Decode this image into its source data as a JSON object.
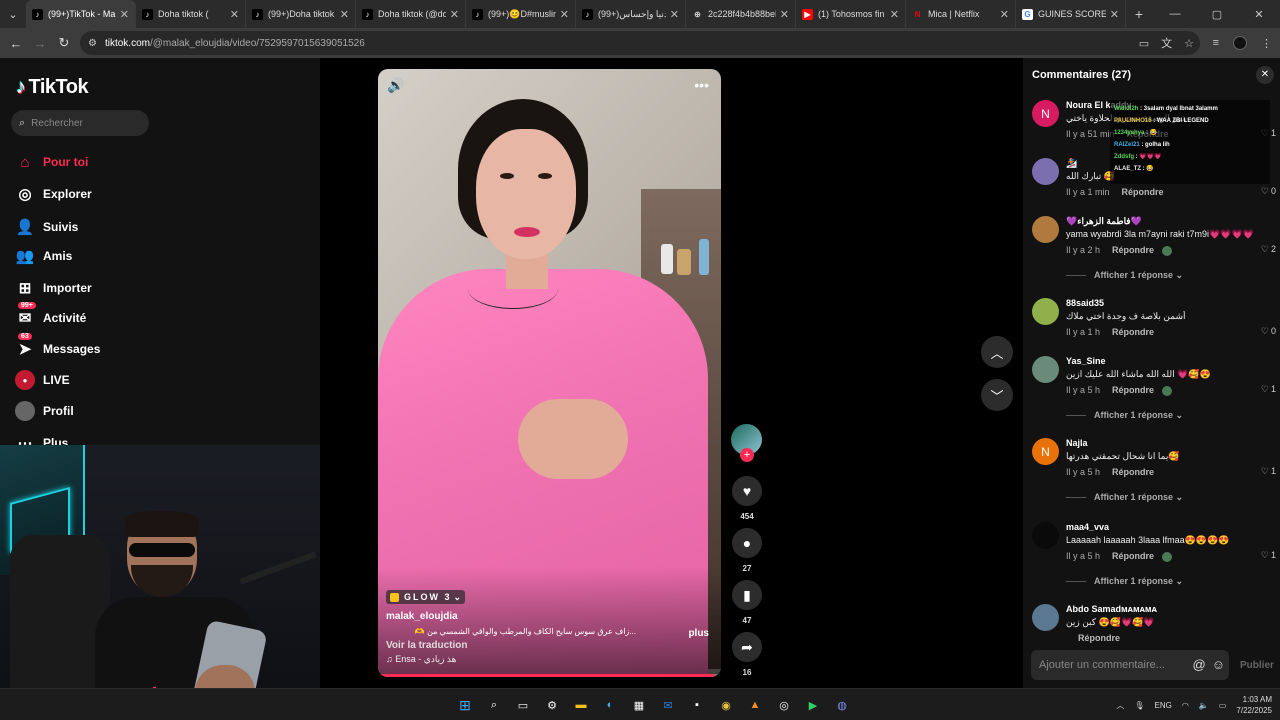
{
  "browser": {
    "tabs": [
      {
        "title": "(99+)TikTok - Mal",
        "icon": "tiktok-icon",
        "active": true
      },
      {
        "title": "Doha tiktok (",
        "icon": "tiktok-icon",
        "active": false
      },
      {
        "title": "(99+)Doha tiktok",
        "icon": "tiktok-icon",
        "active": false
      },
      {
        "title": "Doha tiktok (@do",
        "icon": "tiktok-icon",
        "active": false
      },
      {
        "title": "(99+)😊D#muslin",
        "icon": "tiktok-icon",
        "active": false
      },
      {
        "title": "(99+)دنيا وإحساس",
        "icon": "tiktok-icon",
        "active": false
      },
      {
        "title": "2c228f4b4b88bel",
        "icon": "globe-icon",
        "active": false
      },
      {
        "title": "(1) Tohosmos fin",
        "icon": "youtube-icon",
        "active": false
      },
      {
        "title": "Mica | Netflix",
        "icon": "netflix-icon",
        "active": false
      },
      {
        "title": "GUINES SCORE -",
        "icon": "google-icon",
        "active": false
      }
    ],
    "url_host": "tiktok.com",
    "url_path": "/@malak_eloujdia/video/7529597015639051526"
  },
  "sidebar": {
    "logo": "TikTok",
    "search_placeholder": "Rechercher",
    "items": [
      {
        "label": "Pour toi",
        "icon": "home-icon"
      },
      {
        "label": "Explorer",
        "icon": "compass-icon"
      },
      {
        "label": "Suivis",
        "icon": "following-icon"
      },
      {
        "label": "Amis",
        "icon": "friends-icon"
      },
      {
        "label": "Importer",
        "icon": "upload-icon"
      },
      {
        "label": "Activité",
        "icon": "activity-icon",
        "badge": "99+"
      },
      {
        "label": "Messages",
        "icon": "messages-icon",
        "badge": "63"
      },
      {
        "label": "LIVE",
        "icon": "live-icon"
      },
      {
        "label": "Profil",
        "icon": "profile-icon"
      },
      {
        "label": "Plus",
        "icon": "more-icon"
      }
    ]
  },
  "video": {
    "effect": "GLOW 3",
    "username": "malak_eloujdia",
    "description": "...زاف عرق سوس سايح الكاف والمرطب والواقي الشمسي من 🫶",
    "more": "plus",
    "translate": "Voir la traduction",
    "music": "Ensa - هذ زيادي",
    "progress": 0.98
  },
  "actions": {
    "likes": "454",
    "comments": "27",
    "saves": "47",
    "shares": "16"
  },
  "comments": {
    "header": "Commentaires (27)",
    "reply_label": "Répondre",
    "items": [
      {
        "name": "Noura El kaddy",
        "text": "شنو الوصفة سحري لحلاوة ياختي",
        "time": "Il y a 51 min",
        "likes": "1",
        "avatar": "N",
        "avatar_color": "#d81b60",
        "more": ""
      },
      {
        "name": "🏂",
        "text": "تبارك الله 🥰",
        "time": "Il y a 1 min",
        "likes": "0",
        "avatar": "",
        "avatar_color": "#7c6fb0",
        "more": ""
      },
      {
        "name": "💜فاطمة الزهراء💜",
        "text": "yama wyabrdi 3la m7ayni raki t7m9i💗💗💗💗",
        "time": "Il y a 2 h",
        "likes": "2",
        "avatar": "",
        "avatar_color": "#b07a3e",
        "more": "Afficher 1 réponse"
      },
      {
        "name": "88said35",
        "text": "أشمن بلاصة ف وجدة اختي ملاك",
        "time": "Il y a 1 h",
        "likes": "0",
        "avatar": "",
        "avatar_color": "#8fb04a",
        "more": ""
      },
      {
        "name": "Yas_Sine",
        "text": "الله الله ماشاء الله عليك ازين 💗🥰😍",
        "time": "Il y a 5 h",
        "likes": "1",
        "avatar": "",
        "avatar_color": "#6a8a7a",
        "more": "Afficher 1 réponse"
      },
      {
        "name": "Najla",
        "text": "يما انا شحال تحمقتي هدرتها🥰",
        "time": "Il y a 5 h",
        "likes": "1",
        "avatar": "N",
        "avatar_color": "#e8710a",
        "more": "Afficher 1 réponse"
      },
      {
        "name": "maa4_vva",
        "text": "Laaaaah laaaaah 3laaa lfmaa😍😍😍😍",
        "time": "Il y a 5 h",
        "likes": "1",
        "avatar": "",
        "avatar_color": "#0a0a0a",
        "more": "Afficher 1 réponse"
      },
      {
        "name": "Abdo Samadᴍᴀᴍᴀᴍᴀ",
        "text": "كبن زين 😍🥰💗🥰💗",
        "time": "",
        "likes": "",
        "avatar": "",
        "avatar_color": "#5a7890",
        "more": ""
      }
    ],
    "input_placeholder": "Ajouter un commentaire...",
    "publish": "Publier"
  },
  "chat_overlay": [
    {
      "user": "Walidl2h",
      "msg": "3salam dyal lbnat 3alamm",
      "color": "#5cd65c"
    },
    {
      "user": "PAULINHO15",
      "msg": "WAA ZBI LEGEND",
      "color": "#e8c440"
    },
    {
      "user": "1234yahya",
      "msg": "😂",
      "color": "#5cd65c"
    },
    {
      "user": "RAIZel21",
      "msg": "golha lih",
      "color": "#40b0e8"
    },
    {
      "user": "Zddsfg",
      "msg": "💗💗💗",
      "color": "#5cd65c"
    },
    {
      "user": "ALAE_TZ",
      "msg": "😂",
      "color": "#e8e8e8"
    }
  ],
  "taskbar": {
    "lang": "ENG",
    "time": "1:03 AM",
    "date": "7/22/2025"
  }
}
